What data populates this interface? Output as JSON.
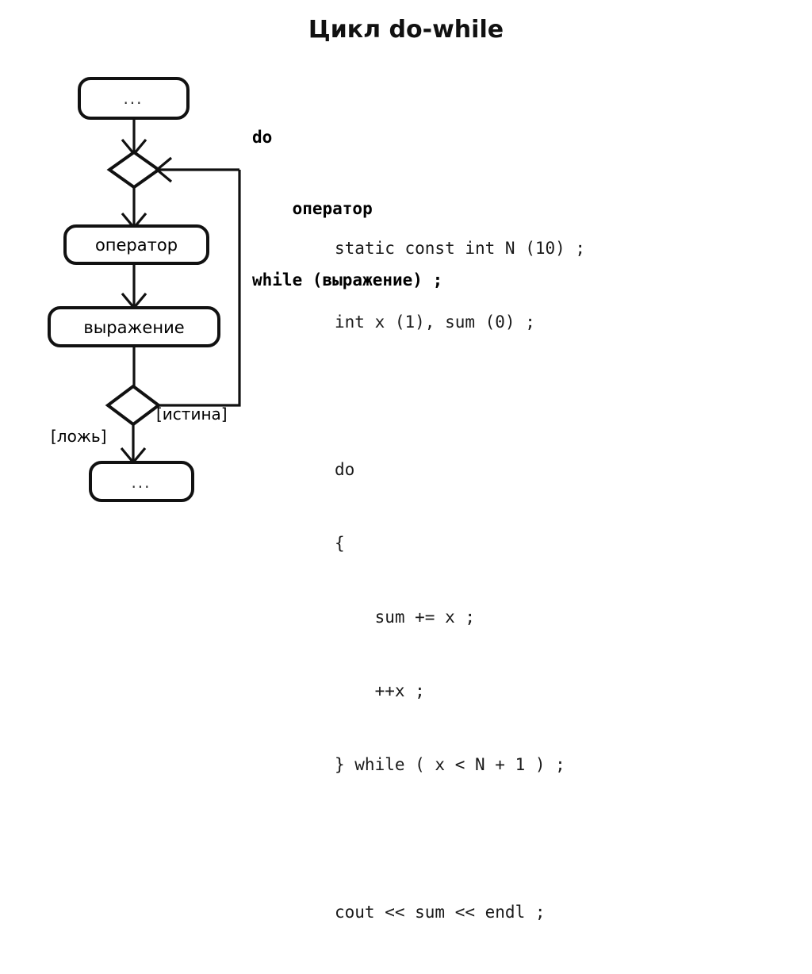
{
  "slide": {
    "title": "Цикл do-while",
    "background_color": "#ffffff",
    "text_color": "#000000"
  },
  "flowchart": {
    "start_node_label": "...",
    "merge_node_label": "",
    "statement_node_label": "оператор",
    "condition_node_label": "выражение",
    "decision_node_label": "",
    "end_node_label": "...",
    "guard_true_label": "[истина]",
    "guard_false_label": "[ложь]",
    "stroke_color": "#111111",
    "fill_color": "#ffffff"
  },
  "syntax": {
    "lines": [
      "do",
      "    оператор",
      "while (выражение) ;"
    ]
  },
  "example": {
    "lines": [
      "static const int N (10) ;",
      "int x (1), sum (0) ;",
      "",
      "do",
      "{",
      "    sum += x ;",
      "    ++x ;",
      "} while ( x < N + 1 ) ;",
      "",
      "cout << sum << endl ;"
    ]
  }
}
